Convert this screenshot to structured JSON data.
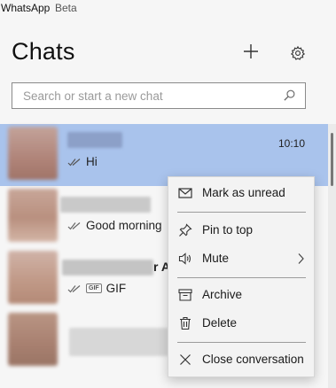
{
  "app": {
    "name": "WhatsApp",
    "tag": "Beta"
  },
  "header": {
    "title": "Chats",
    "new_chat_icon": "plus-icon",
    "settings_icon": "gear-icon"
  },
  "search": {
    "placeholder": "Search or start a new chat",
    "value": "",
    "icon": "search-icon"
  },
  "chats": [
    {
      "time": "10:10",
      "preview": "Hi",
      "status": "double-check",
      "selected": true
    },
    {
      "preview": "Good morning",
      "status": "double-check"
    },
    {
      "name_peek": "r A",
      "preview": "GIF",
      "badge": "GIF",
      "status": "double-check"
    },
    {
      "preview": ""
    }
  ],
  "context_menu": {
    "items": [
      {
        "label": "Mark as unread",
        "icon": "mail-icon"
      },
      {
        "label": "Pin to top",
        "icon": "pin-icon"
      },
      {
        "label": "Mute",
        "icon": "speaker-icon",
        "has_submenu": true
      },
      {
        "label": "Archive",
        "icon": "archive-icon"
      },
      {
        "label": "Delete",
        "icon": "trash-icon"
      },
      {
        "label": "Close conversation",
        "icon": "close-icon"
      }
    ]
  },
  "colors": {
    "selected_row": "#a9c3ec",
    "background": "#f6f6f6",
    "menu_background": "#f3f3f3"
  }
}
